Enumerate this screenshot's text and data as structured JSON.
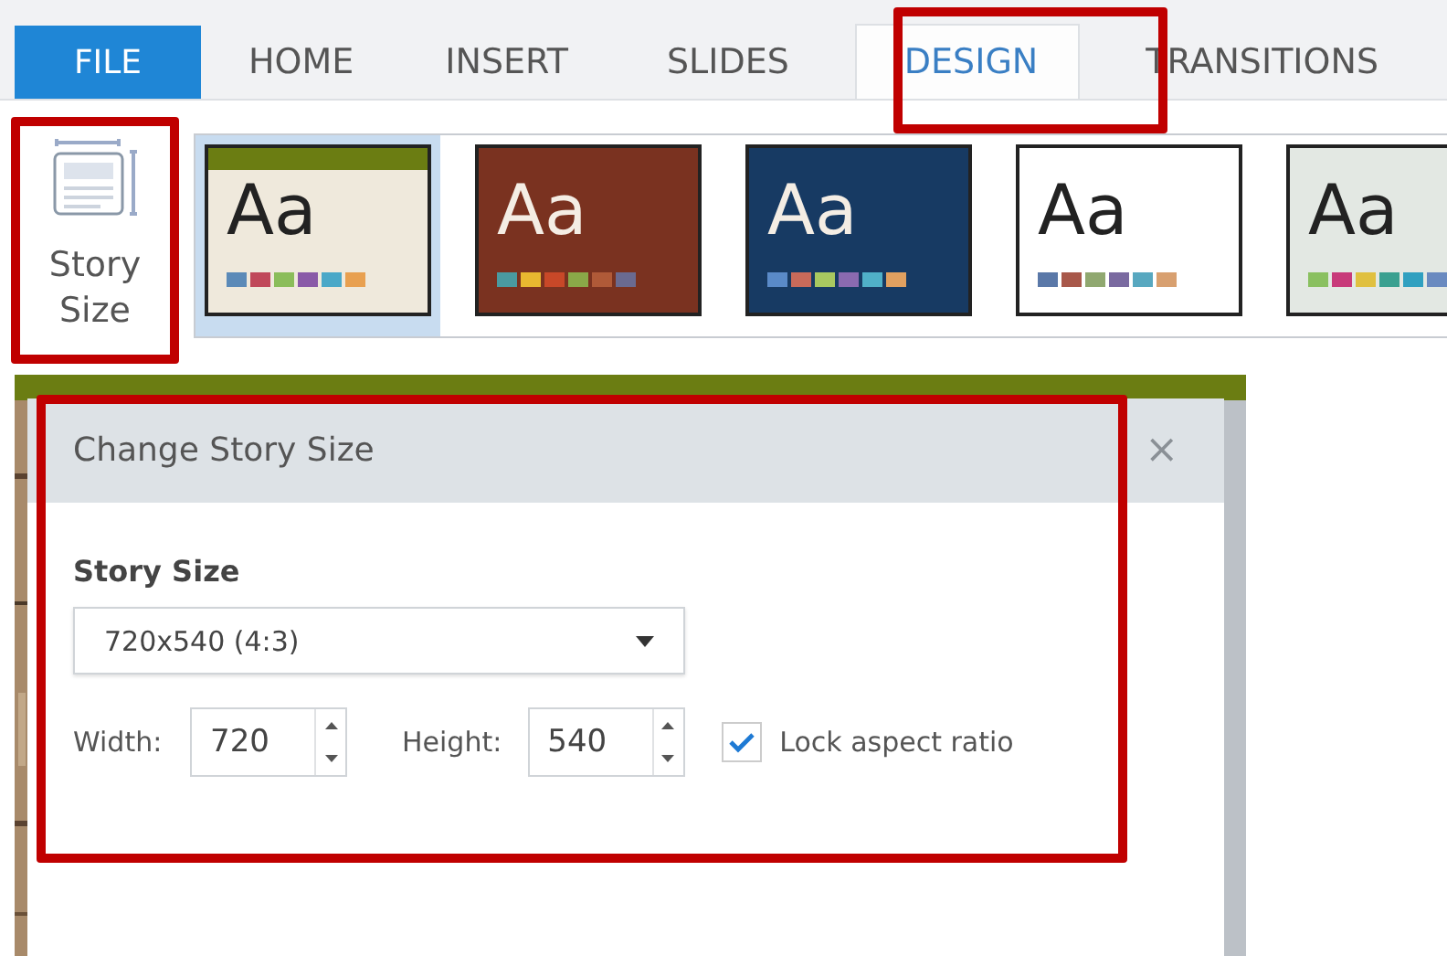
{
  "tabs": [
    {
      "label": "FILE",
      "kind": "file",
      "selected": false
    },
    {
      "label": "HOME",
      "kind": "tab",
      "selected": false
    },
    {
      "label": "INSERT",
      "kind": "tab",
      "selected": false
    },
    {
      "label": "SLIDES",
      "kind": "tab",
      "selected": false
    },
    {
      "label": "DESIGN",
      "kind": "tab",
      "selected": true
    },
    {
      "label": "TRANSITIONS",
      "kind": "tab",
      "selected": false
    }
  ],
  "ribbon": {
    "story_size_button": {
      "label_lines": [
        "Story",
        "Size"
      ]
    },
    "themes": [
      {
        "label": "Aa",
        "selected": true,
        "color": "#efe9dc"
      },
      {
        "label": "Aa",
        "selected": false,
        "color": "#7a3220"
      },
      {
        "label": "Aa",
        "selected": false,
        "color": "#173a63"
      },
      {
        "label": "Aa",
        "selected": false,
        "color": "#ffffff"
      },
      {
        "label": "Aa",
        "selected": false,
        "color": "#e3e8e3"
      }
    ]
  },
  "dialog": {
    "title": "Change Story Size",
    "close": "×",
    "section_label": "Story Size",
    "size_select": {
      "value": "720x540 (4:3)"
    },
    "width": {
      "label": "Width:",
      "value": "720"
    },
    "height": {
      "label": "Height:",
      "value": "540"
    },
    "lock_aspect": {
      "label": "Lock aspect ratio",
      "checked": true
    }
  }
}
